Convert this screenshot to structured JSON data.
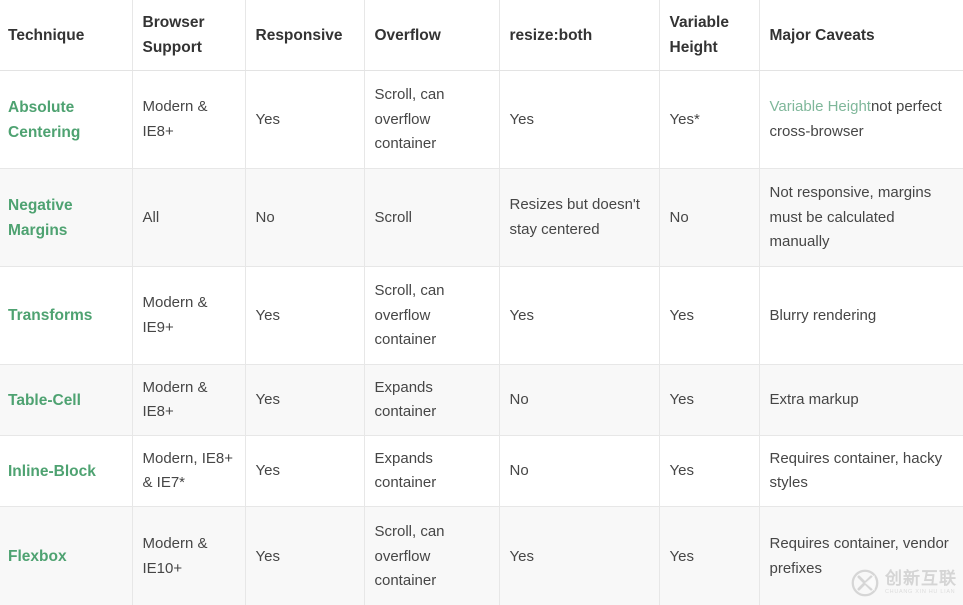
{
  "table": {
    "headers": [
      "Technique",
      "Browser Support",
      "Responsive",
      "Overflow",
      "resize:both",
      "Variable Height",
      "Major Caveats"
    ],
    "rows": [
      {
        "technique": "Absolute Centering",
        "browser_support": "Modern & IE8+",
        "responsive": "Yes",
        "overflow": "Scroll, can overflow container",
        "resize_both": "Yes",
        "variable_height": "Yes*",
        "caveats_link": "Variable Height",
        "caveats_rest": "not perfect cross-browser"
      },
      {
        "technique": "Negative Margins",
        "browser_support": "All",
        "responsive": "No",
        "overflow": "Scroll",
        "resize_both": "Resizes but doesn't stay centered",
        "variable_height": "No",
        "caveats_link": "",
        "caveats_rest": "Not responsive, margins must be calculated manually"
      },
      {
        "technique": "Transforms",
        "browser_support": "Modern & IE9+",
        "responsive": "Yes",
        "overflow": "Scroll, can overflow container",
        "resize_both": "Yes",
        "variable_height": "Yes",
        "caveats_link": "",
        "caveats_rest": "Blurry rendering"
      },
      {
        "technique": "Table-Cell",
        "browser_support": "Modern & IE8+",
        "responsive": "Yes",
        "overflow": "Expands container",
        "resize_both": "No",
        "variable_height": "Yes",
        "caveats_link": "",
        "caveats_rest": "Extra markup"
      },
      {
        "technique": "Inline-Block",
        "browser_support": "Modern, IE8+ & IE7*",
        "responsive": "Yes",
        "overflow": "Expands container",
        "resize_both": "No",
        "variable_height": "Yes",
        "caveats_link": "",
        "caveats_rest": "Requires container, hacky styles"
      },
      {
        "technique": "Flexbox",
        "browser_support": "Modern & IE10+",
        "responsive": "Yes",
        "overflow": "Scroll, can overflow container",
        "resize_both": "Yes",
        "variable_height": "Yes",
        "caveats_link": "",
        "caveats_rest": "Requires container, vendor prefixes"
      }
    ]
  },
  "watermark": {
    "logo": "circled-x-logo",
    "chinese": "创新互联",
    "english": "CHUANG XIN HU LIAN"
  },
  "colors": {
    "link_green": "#4ea271",
    "inline_link_green": "#7fb79a",
    "header_text": "#333333",
    "body_text": "#464646",
    "row_alt_bg": "#f8f8f8",
    "border": "#e7e7e7"
  }
}
